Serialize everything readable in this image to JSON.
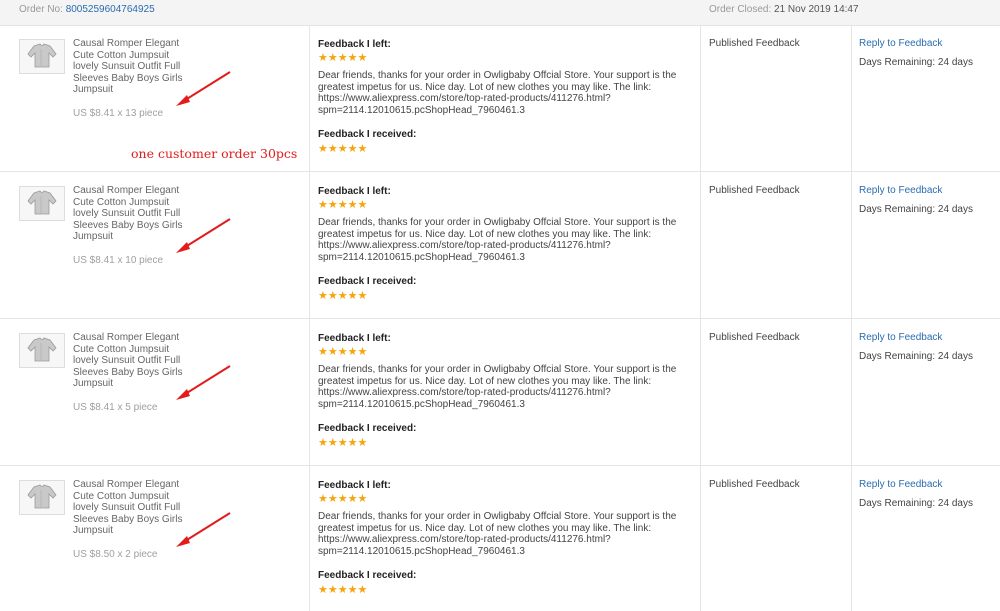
{
  "header": {
    "order_label": "Order No:",
    "order_number": "8005259604764925",
    "closed_label": "Order Closed:",
    "closed_date": "21 Nov 2019 14:47"
  },
  "annotation": "one customer order 30pcs",
  "colors": {
    "link": "#2b6cb0",
    "star": "#f5a40c",
    "annotation_red": "#e21b1b"
  },
  "rows": [
    {
      "product_line1": "Causal Romper Elegant",
      "product_line2": "Cute Cotton Jumpsuit",
      "product_line3": "lovely Sunsuit Outfit Full",
      "product_line4": "Sleeves Baby Boys Girls",
      "product_line5": "Jumpsuit",
      "price": "US $8.41 x 13 piece",
      "feedback_left_label": "Feedback I left:",
      "stars_left": "★★★★★",
      "text_line1": "Dear friends, thanks for your order in Owligbaby Offcial Store. Your support is the",
      "text_line2": "greatest impetus for us. Nice day. Lot of new clothes you may like. The link:",
      "text_line3": "https://www.aliexpress.com/store/top-rated-products/411276.html?",
      "text_line4": "spm=2114.12010615.pcShopHead_7960461.3",
      "feedback_received_label": "Feedback I received:",
      "stars_received": "★★★★★",
      "status": "Published Feedback",
      "reply": "Reply to Feedback",
      "days_remaining": "Days Remaining: 24 days"
    },
    {
      "product_line1": "Causal Romper Elegant",
      "product_line2": "Cute Cotton Jumpsuit",
      "product_line3": "lovely Sunsuit Outfit Full",
      "product_line4": "Sleeves Baby Boys Girls",
      "product_line5": "Jumpsuit",
      "price": "US $8.41 x 10 piece",
      "feedback_left_label": "Feedback I left:",
      "stars_left": "★★★★★",
      "text_line1": "Dear friends, thanks for your order in Owligbaby Offcial Store. Your support is the",
      "text_line2": "greatest impetus for us. Nice day. Lot of new clothes you may like. The link:",
      "text_line3": "https://www.aliexpress.com/store/top-rated-products/411276.html?",
      "text_line4": "spm=2114.12010615.pcShopHead_7960461.3",
      "feedback_received_label": "Feedback I received:",
      "stars_received": "★★★★★",
      "status": "Published Feedback",
      "reply": "Reply to Feedback",
      "days_remaining": "Days Remaining: 24 days"
    },
    {
      "product_line1": "Causal Romper Elegant",
      "product_line2": "Cute Cotton Jumpsuit",
      "product_line3": "lovely Sunsuit Outfit Full",
      "product_line4": "Sleeves Baby Boys Girls",
      "product_line5": "Jumpsuit",
      "price": "US $8.41 x 5 piece",
      "feedback_left_label": "Feedback I left:",
      "stars_left": "★★★★★",
      "text_line1": "Dear friends, thanks for your order in Owligbaby Offcial Store. Your support is the",
      "text_line2": "greatest impetus for us. Nice day. Lot of new clothes you may like. The link:",
      "text_line3": "https://www.aliexpress.com/store/top-rated-products/411276.html?",
      "text_line4": "spm=2114.12010615.pcShopHead_7960461.3",
      "feedback_received_label": "Feedback I received:",
      "stars_received": "★★★★★",
      "status": "Published Feedback",
      "reply": "Reply to Feedback",
      "days_remaining": "Days Remaining: 24 days"
    },
    {
      "product_line1": "Causal Romper Elegant",
      "product_line2": "Cute Cotton Jumpsuit",
      "product_line3": "lovely Sunsuit Outfit Full",
      "product_line4": "Sleeves Baby Boys Girls",
      "product_line5": "Jumpsuit",
      "price": "US $8.50 x 2 piece",
      "feedback_left_label": "Feedback I left:",
      "stars_left": "★★★★★",
      "text_line1": "Dear friends, thanks for your order in Owligbaby Offcial Store. Your support is the",
      "text_line2": "greatest impetus for us. Nice day. Lot of new clothes you may like. The link:",
      "text_line3": "https://www.aliexpress.com/store/top-rated-products/411276.html?",
      "text_line4": "spm=2114.12010615.pcShopHead_7960461.3",
      "feedback_received_label": "Feedback I received:",
      "stars_received": "★★★★★",
      "status": "Published Feedback",
      "reply": "Reply to Feedback",
      "days_remaining": "Days Remaining: 24 days"
    }
  ]
}
